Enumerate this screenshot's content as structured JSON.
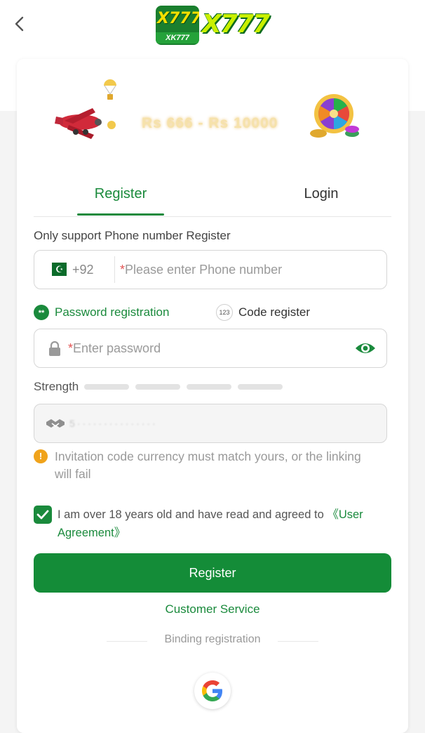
{
  "header": {
    "back_icon": "chevron-left-icon",
    "logo_badge_text": "X777",
    "logo_badge_sub": "XK777",
    "logo_text": "X777"
  },
  "banner": {
    "amount_text": "Rs 666 - Rs 10000"
  },
  "tabs": {
    "register": "Register",
    "login": "Login",
    "active": "Register"
  },
  "form": {
    "hint": "Only support Phone number Register",
    "country_code": "+92",
    "required_mark": "*",
    "phone_placeholder": "Please enter Phone number",
    "mode_password": "Password registration",
    "mode_password_icon": "**",
    "mode_code": "Code register",
    "mode_code_icon": "123",
    "password_placeholder": "Enter password",
    "strength_label": "Strength",
    "invitation_code": "5···············",
    "notice": "Invitation code currency must match yours, or the linking will fail",
    "notice_icon": "!",
    "agreement_text": "I am over 18 years old and have read and agreed to ",
    "agreement_link": "《User Agreement》",
    "agreement_checked": true,
    "submit": "Register",
    "customer_service": "Customer Service",
    "binding": "Binding registration",
    "google_icon": "google-icon"
  },
  "colors": {
    "accent": "#1a8a3c",
    "button": "#148c38",
    "notice": "#f0a31b",
    "required": "#e25555"
  }
}
